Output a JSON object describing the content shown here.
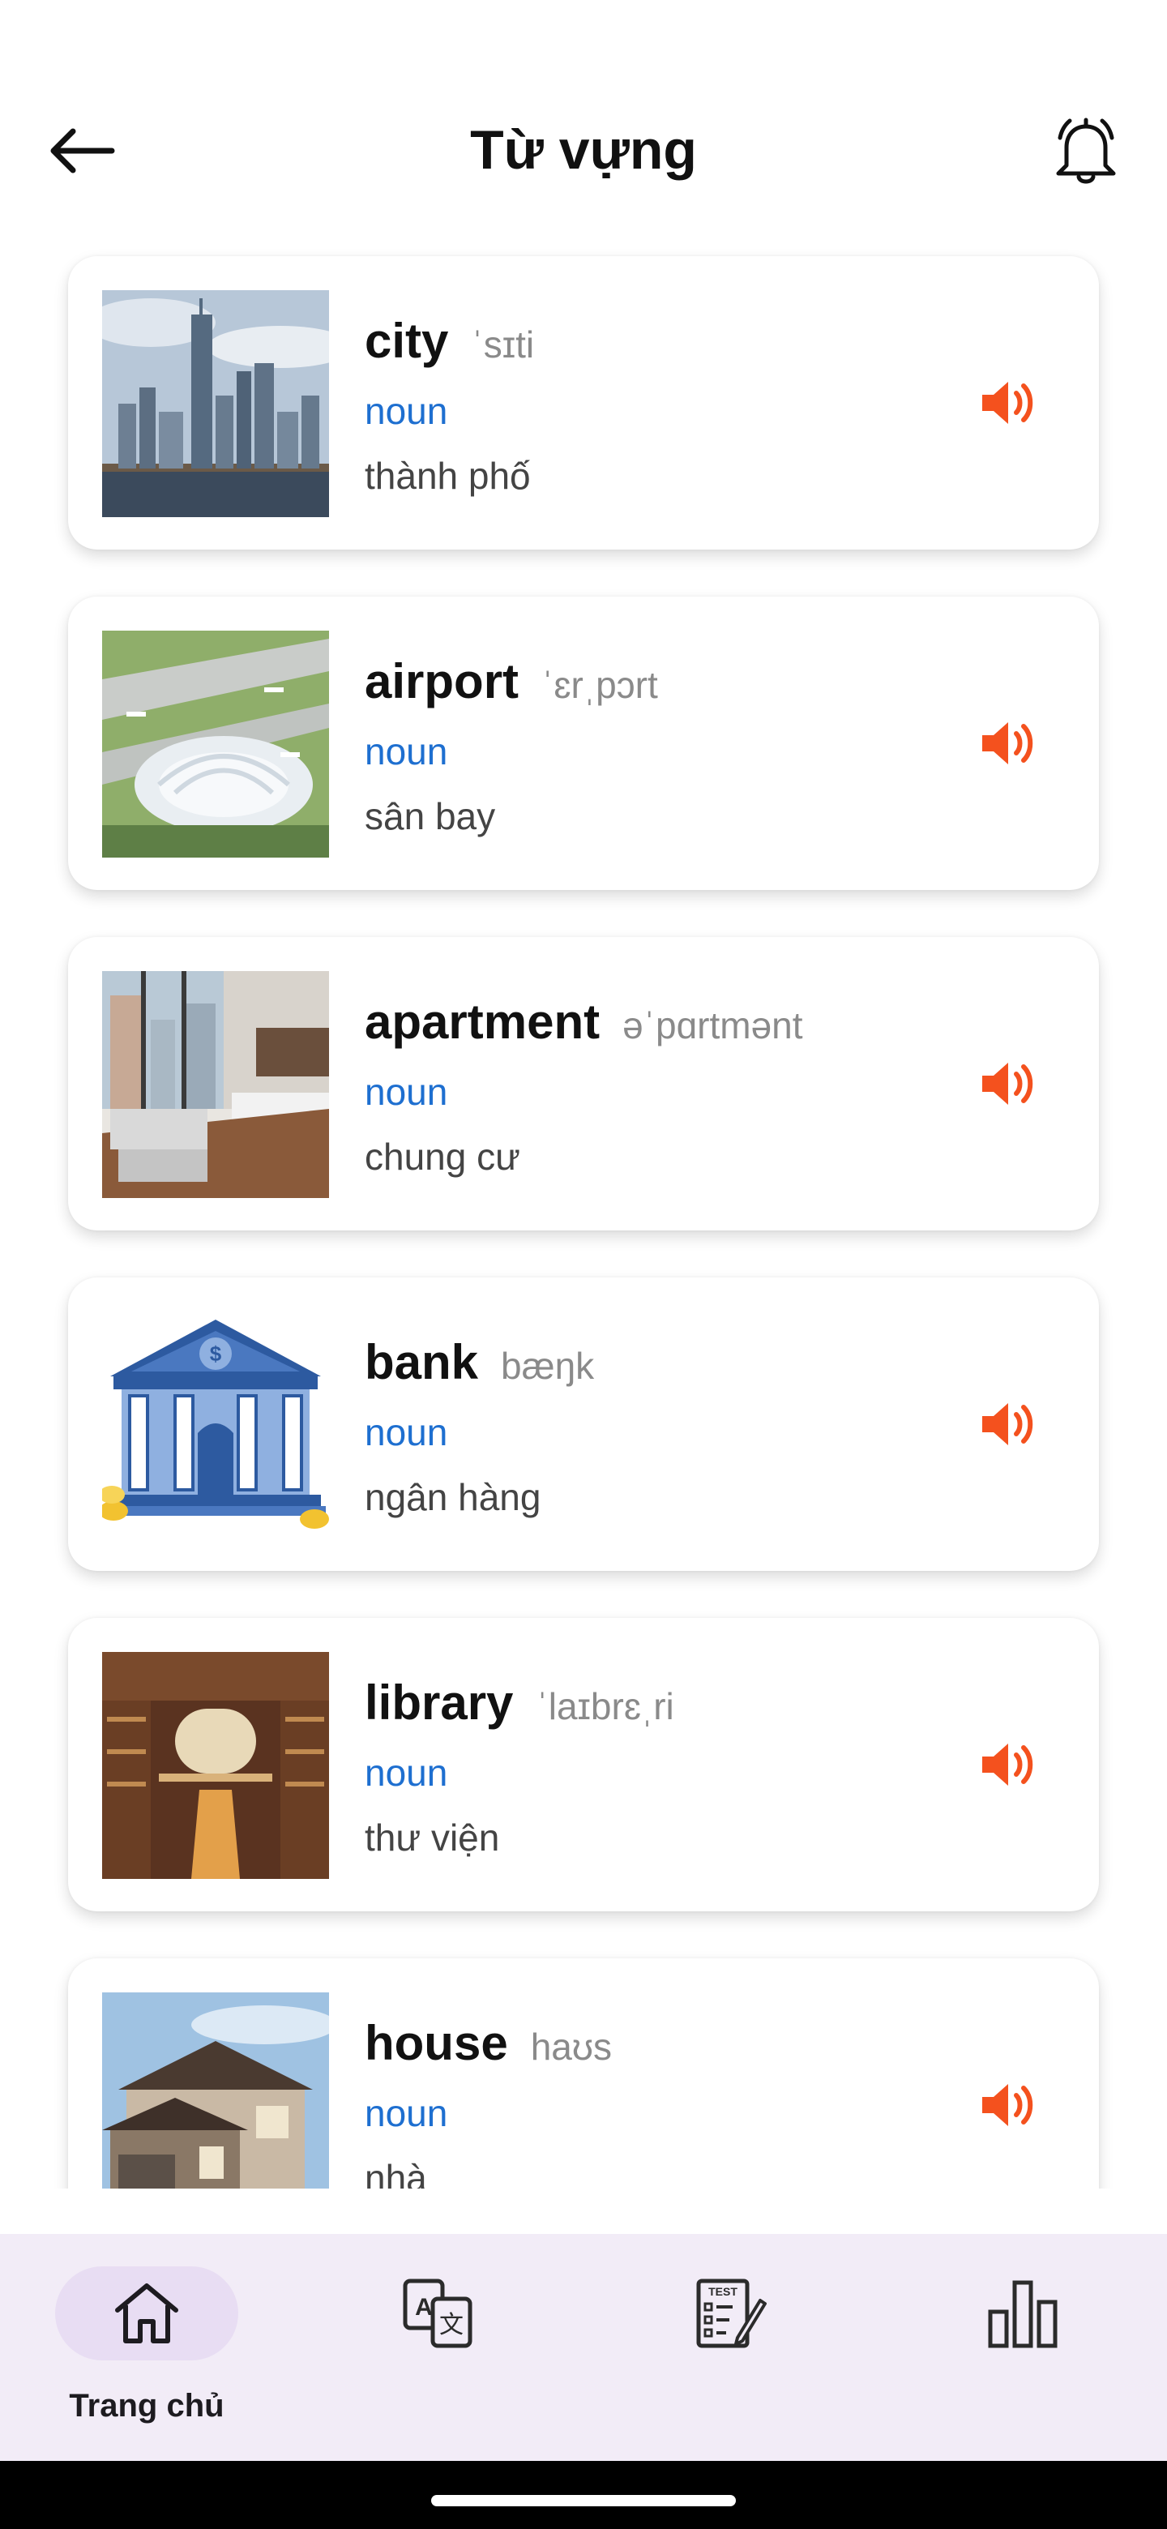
{
  "header": {
    "title": "Từ vựng"
  },
  "vocabulary": [
    {
      "word": "city",
      "ipa": "ˈsɪti",
      "pos": "noun",
      "meaning": "thành phố",
      "image": "city-skyline"
    },
    {
      "word": "airport",
      "ipa": "ˈɛrˌpɔrt",
      "pos": "noun",
      "meaning": "sân bay",
      "image": "airport-aerial"
    },
    {
      "word": "apartment",
      "ipa": "əˈpɑrtmənt",
      "pos": "noun",
      "meaning": "chung cư",
      "image": "apartment-interior"
    },
    {
      "word": "bank",
      "ipa": "bæŋk",
      "pos": "noun",
      "meaning": "ngân hàng",
      "image": "bank-building"
    },
    {
      "word": "library",
      "ipa": "ˈlaɪbrɛˌri",
      "pos": "noun",
      "meaning": "thư viện",
      "image": "library-hall"
    },
    {
      "word": "house",
      "ipa": "haʊs",
      "pos": "noun",
      "meaning": "nhà",
      "image": "house-exterior"
    }
  ],
  "icons": {
    "back": "arrow-left-icon",
    "notifications": "bell-icon",
    "audio": "speaker-icon"
  },
  "nav": {
    "items": [
      {
        "label": "Trang chủ",
        "icon": "home-icon",
        "active": true
      },
      {
        "label": "",
        "icon": "translate-icon",
        "active": false
      },
      {
        "label": "",
        "icon": "test-icon",
        "active": false
      },
      {
        "label": "",
        "icon": "bar-chart-icon",
        "active": false
      }
    ]
  },
  "colors": {
    "accent": "#f4511e",
    "pos_blue": "#1e6fd0",
    "nav_bg": "#f2ecf7",
    "nav_active_pill": "#e8ddf3"
  }
}
